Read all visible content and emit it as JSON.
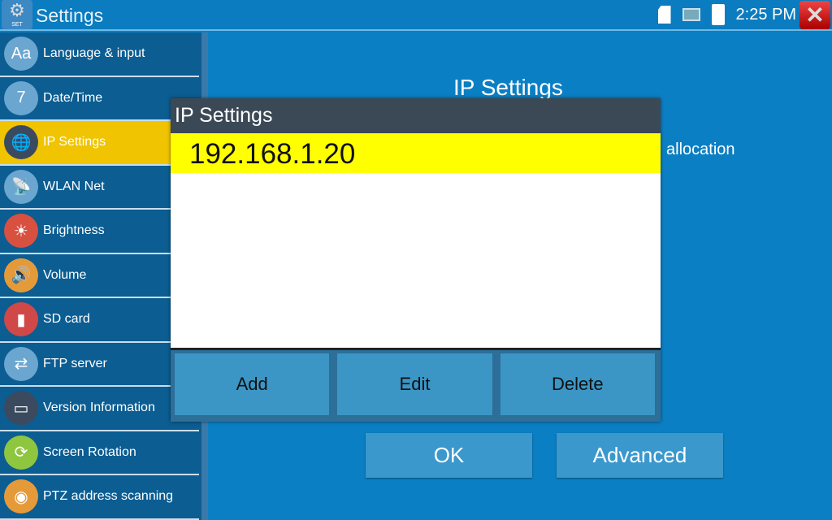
{
  "topbar": {
    "title": "Settings",
    "app_icon_label": "SET",
    "time": "2:25 PM"
  },
  "sidebar": {
    "items": [
      {
        "label": "Language & input",
        "icon": "Aa",
        "color": "#6aa6cf"
      },
      {
        "label": "Date/Time",
        "icon": "7",
        "color": "#6aa6cf"
      },
      {
        "label": "IP Settings",
        "icon": "🌐",
        "color": "#3b4a5e",
        "selected": true
      },
      {
        "label": "WLAN Net",
        "icon": "📡",
        "color": "#6aa6cf"
      },
      {
        "label": "Brightness",
        "icon": "☀",
        "color": "#d85040"
      },
      {
        "label": "Volume",
        "icon": "🔊",
        "color": "#e59a3a"
      },
      {
        "label": "SD card",
        "icon": "▮",
        "color": "#d04848"
      },
      {
        "label": "FTP server",
        "icon": "⇄",
        "color": "#6aa6cf"
      },
      {
        "label": "Version Information",
        "icon": "▭",
        "color": "#3b4a5e"
      },
      {
        "label": "Screen Rotation",
        "icon": "⟳",
        "color": "#8ec63f"
      },
      {
        "label": "PTZ address scanning",
        "icon": "◉",
        "color": "#e59a3a"
      }
    ]
  },
  "main": {
    "title": "IP Settings",
    "allocation_text": "allocation",
    "ok_label": "OK",
    "advanced_label": "Advanced"
  },
  "dialog": {
    "title": "IP Settings",
    "entries": [
      "192.168.1.20"
    ],
    "add_label": "Add",
    "edit_label": "Edit",
    "delete_label": "Delete"
  }
}
